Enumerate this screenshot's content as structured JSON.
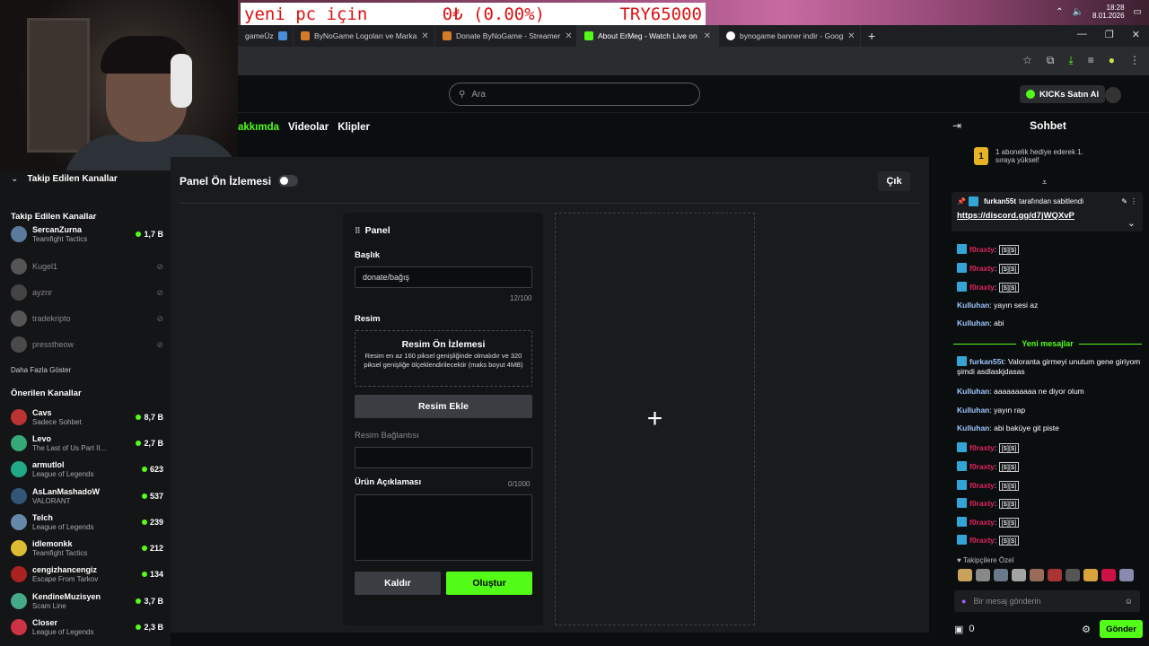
{
  "desktop": {
    "banner_left": "yeni pc için",
    "banner_mid": "0₺ (0.00%)",
    "banner_right": "TRY65000",
    "clock_time": "18:28",
    "clock_date": "8.01.2026"
  },
  "browser": {
    "tabs": [
      {
        "label": "gameÜz",
        "fav": "#4a90d9"
      },
      {
        "label": "ByNoGame Logoları ve Marka",
        "fav": "#d47b2a"
      },
      {
        "label": "Donate ByNoGame - Streamer",
        "fav": "#d47b2a"
      },
      {
        "label": "About ErMeg - Watch Live on",
        "fav": "#53fc18",
        "active": true
      },
      {
        "label": "bynogame banner indir - Goog",
        "fav": "#ffffff"
      }
    ],
    "new_tab": "+"
  },
  "header": {
    "search_placeholder": "Ara",
    "kicks_label": "KICKs Satın Al"
  },
  "subnav": {
    "tabs": [
      "akkımda",
      "Videolar",
      "Klipler"
    ]
  },
  "sidebar": {
    "followed_title": "Takip Edilen Kanallar",
    "followed_collapsed": "Takip Edilen Kanallar",
    "followed": [
      {
        "name": "SercanZurna",
        "game": "Teamfight Tactics",
        "viewers": "1,7 B",
        "live": true,
        "color": "#5a7a9e"
      },
      {
        "name": "Kugel1",
        "game": "",
        "viewers": "",
        "live": false,
        "color": "#555"
      },
      {
        "name": "ayznr",
        "game": "",
        "viewers": "",
        "live": false,
        "color": "#444"
      },
      {
        "name": "tradekripto",
        "game": "",
        "viewers": "",
        "live": false,
        "color": "#555"
      },
      {
        "name": "presstheow",
        "game": "",
        "viewers": "",
        "live": false,
        "color": "#4a4a4a"
      }
    ],
    "show_more": "Daha Fazla Göster",
    "recommended_title": "Önerilen Kanallar",
    "recommended": [
      {
        "name": "Cavs",
        "game": "Sadece Sohbet",
        "viewers": "8,7 B",
        "color": "#b33"
      },
      {
        "name": "Levo",
        "game": "The Last of Us Part II...",
        "viewers": "2,7 B",
        "color": "#3a7"
      },
      {
        "name": "armutlol",
        "game": "League of Legends",
        "viewers": "623",
        "color": "#2a8"
      },
      {
        "name": "AsLanMashadoW",
        "game": "VALORANT",
        "viewers": "537",
        "color": "#357"
      },
      {
        "name": "Telch",
        "game": "League of Legends",
        "viewers": "239",
        "color": "#68a"
      },
      {
        "name": "idlemonkk",
        "game": "Teamfight Tactics",
        "viewers": "212",
        "color": "#db3"
      },
      {
        "name": "cengizhancengiz",
        "game": "Escape From Tarkov",
        "viewers": "134",
        "color": "#a22"
      },
      {
        "name": "KendineMuzisyen",
        "game": "Scam Line",
        "viewers": "3,7 B",
        "color": "#4a8"
      },
      {
        "name": "Closer",
        "game": "League of Legends",
        "viewers": "2,3 B",
        "color": "#c34"
      }
    ]
  },
  "main": {
    "preview_label": "Panel Ön İzlemesi",
    "exit_label": "Çık",
    "editor_title": "Panel",
    "title_label": "Başlık",
    "title_value": "donate/bağış",
    "title_count": "12/100",
    "image_label": "Resim",
    "image_preview_title": "Resim Ön İzlemesi",
    "image_preview_desc": "Resim en az 160 piksel genişliğinde olmalıdır ve 320 piksel genişliğe ölçeklendirilecektir (maks boyut 4MB)",
    "add_image_button": "Resim Ekle",
    "image_link_label": "Resim Bağlantısı",
    "desc_label": "Ürün Açıklaması",
    "desc_count": "0/1000",
    "remove_button": "Kaldır",
    "create_button": "Oluştur",
    "add_panel_symbol": "+"
  },
  "chat": {
    "title": "Sohbet",
    "sub_goal_number": "1",
    "sub_goal_text": "1 abonelik hediye ederek 1. sıraya yüksel!",
    "pinned_by_user": "furkan55t",
    "pinned_by_text": "tarafından sabitlendi",
    "pinned_link": "https://discord.gg/d7jWQXvP",
    "new_messages": "Yeni mesajlar",
    "messages_top": [
      {
        "user": "f0raxty",
        "text": "[$][$]",
        "badge": true,
        "color": "#e0245e"
      },
      {
        "user": "f0raxty",
        "text": "[$][$]",
        "badge": true,
        "color": "#e0245e"
      },
      {
        "user": "f0raxty",
        "text": "[$][$]",
        "badge": true,
        "color": "#e0245e"
      },
      {
        "user": "Kulluhan",
        "text": "yayın sesi az",
        "badge": false,
        "color": "#9ec5ff"
      },
      {
        "user": "Kulluhan",
        "text": "abi",
        "badge": false,
        "color": "#9ec5ff"
      }
    ],
    "messages_bottom": [
      {
        "user": "furkan55t",
        "text": "Valoranta girmeyi unutum gene giriyom şimdi asdlaskjdasas",
        "badge": true,
        "color": "#9ec5ff"
      },
      {
        "user": "Kulluhan",
        "text": "aaaaaaaaaa ne diyor olum",
        "badge": false,
        "color": "#9ec5ff"
      },
      {
        "user": "Kulluhan",
        "text": "yayın rap",
        "badge": false,
        "color": "#9ec5ff"
      },
      {
        "user": "Kulluhan",
        "text": "abi baküye git piste",
        "badge": false,
        "color": "#9ec5ff"
      },
      {
        "user": "f0raxty",
        "text": "[$][$]",
        "badge": true,
        "color": "#e0245e"
      },
      {
        "user": "f0raxty",
        "text": "[$][$]",
        "badge": true,
        "color": "#e0245e"
      },
      {
        "user": "f0raxty",
        "text": "[$][$]",
        "badge": true,
        "color": "#e0245e"
      },
      {
        "user": "f0raxty",
        "text": "[$][$]",
        "badge": true,
        "color": "#e0245e"
      },
      {
        "user": "f0raxty",
        "text": "[$][$]",
        "badge": true,
        "color": "#e0245e"
      },
      {
        "user": "f0raxty",
        "text": "[$][$]",
        "badge": true,
        "color": "#e0245e"
      }
    ],
    "follower_only": "Takipçilere Özel",
    "input_placeholder": "Bir mesaj gönderin",
    "kicks_count": "0",
    "send_button": "Gönder"
  },
  "colors": {
    "accent": "#53fc18",
    "bg": "#0b0e0f",
    "panel": "#191b1f"
  }
}
